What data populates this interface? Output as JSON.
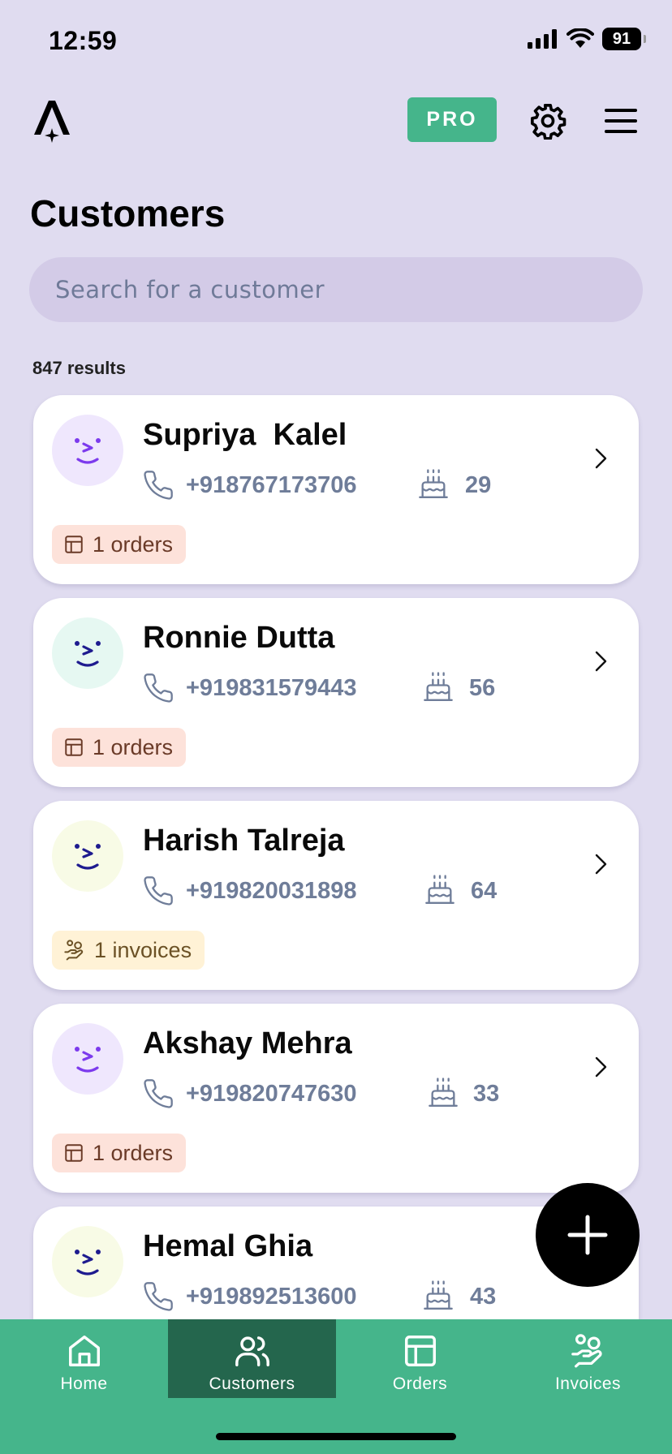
{
  "status_bar": {
    "time": "12:59",
    "battery": "91"
  },
  "header": {
    "pro_label": "PRO"
  },
  "page": {
    "title": "Customers",
    "search_placeholder": "Search for a customer",
    "results_count": "847 results"
  },
  "customers": [
    {
      "name": "Supriya  Kalel",
      "phone": "+918767173706",
      "age": "29",
      "tag_type": "orders",
      "tag_label": "1 orders",
      "avatar_bg": "#efe7fd",
      "face_color": "#7c3aed"
    },
    {
      "name": "Ronnie Dutta",
      "phone": "+919831579443",
      "age": "56",
      "tag_type": "orders",
      "tag_label": "1 orders",
      "avatar_bg": "#e6f8f2",
      "face_color": "#1e1b8f"
    },
    {
      "name": "Harish Talreja",
      "phone": "+919820031898",
      "age": "64",
      "tag_type": "invoices",
      "tag_label": "1 invoices",
      "avatar_bg": "#f8fbe6",
      "face_color": "#1e1b8f"
    },
    {
      "name": "Akshay Mehra",
      "phone": "+919820747630",
      "age": "33",
      "tag_type": "orders",
      "tag_label": "1 orders",
      "avatar_bg": "#efe7fd",
      "face_color": "#7c3aed"
    },
    {
      "name": "Hemal Ghia",
      "phone": "+919892513600",
      "age": "43",
      "tag_type": "",
      "tag_label": "",
      "avatar_bg": "#f8fbe6",
      "face_color": "#1e1b8f"
    }
  ],
  "nav": {
    "home": "Home",
    "customers": "Customers",
    "orders": "Orders",
    "invoices": "Invoices",
    "active": "customers"
  },
  "colors": {
    "background": "#e0dcf0",
    "accent": "#45b58b",
    "nav_active": "#24664d"
  }
}
